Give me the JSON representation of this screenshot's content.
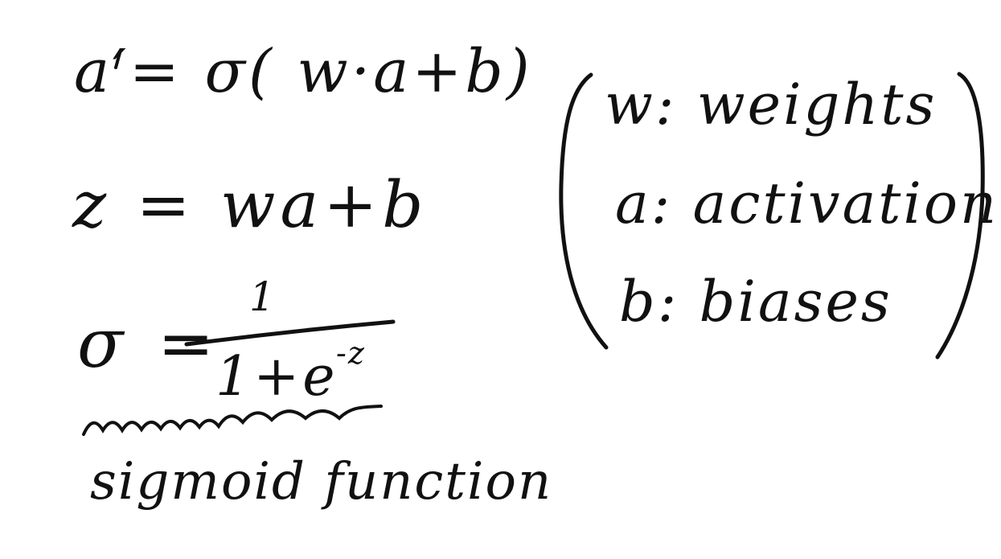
{
  "equations": {
    "activation": "a′= σ( w·a+b)",
    "z_def": "z = wa+b",
    "sigma_lhs": "σ =",
    "fraction_numerator": "1",
    "fraction_denominator": "1+e",
    "fraction_exponent": "-z",
    "caption": "sigmoid function"
  },
  "legend": {
    "weights": "w: weights",
    "activation": "a: activation",
    "biases": "b: biases"
  }
}
